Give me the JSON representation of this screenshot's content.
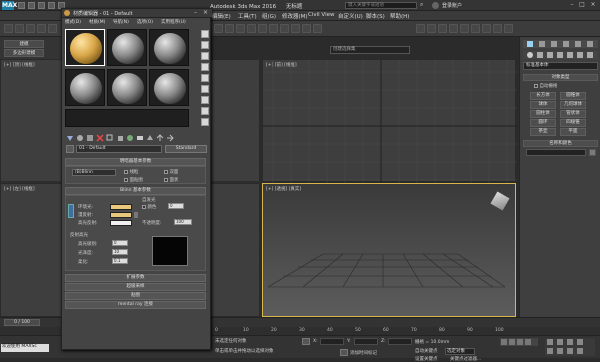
{
  "app": {
    "logo": "MAX",
    "title": "Autodesk 3ds Max 2016",
    "doc_title": "无标题",
    "search_placeholder": "键入关键字或短语",
    "user": "登录账户"
  },
  "menubar": [
    "编辑(E)",
    "工具(T)",
    "组(G)",
    "视图(V)",
    "创建(C)",
    "修改器(M)",
    "动画(A)",
    "图形编辑器(D)",
    "渲染(R)",
    "Civil View",
    "自定义(U)",
    "脚本(S)",
    "帮助(H)"
  ],
  "toolbar": {
    "selection_set": "创建选择集"
  },
  "ribbon": {
    "tab1": "建模",
    "tab2": "多边形建模"
  },
  "viewports": {
    "top_left": "[+] [顶] [线框]",
    "top_right": "[+] [前] [线框]",
    "bottom_left": "[+] [左] [线框]",
    "perspective": "[+] [透视] [真实]"
  },
  "material_editor": {
    "title": "材质编辑器 - 01 - Default",
    "menus": [
      "模式(D)",
      "材质(M)",
      "导航(N)",
      "选项(O)",
      "实用程序(U)"
    ],
    "material_name": "01 - Default",
    "material_type": "Standard",
    "basic_params_header": "明暗器基本参数",
    "shader": "(B)Blinn",
    "checks": [
      "线框",
      "双面",
      "面贴图",
      "面状"
    ],
    "blinn_header": "Blinn 基本参数",
    "self_illum_label": "自发光",
    "color_label": "颜色",
    "color_value": "0",
    "ambient_label": "环境光:",
    "diffuse_label": "漫反射:",
    "specular_label": "高光反射:",
    "opacity_label": "不透明度:",
    "opacity_value": "100",
    "spec_highlights_label": "反射高光",
    "spec_level_label": "高光级别:",
    "spec_level_value": "0",
    "glossiness_label": "光泽度:",
    "glossiness_value": "10",
    "soften_label": "柔化:",
    "soften_value": "0.1",
    "rollouts": [
      "扩展参数",
      "超级采样",
      "贴图",
      "mental ray 连接"
    ]
  },
  "command_panel": {
    "category": "标准基本体",
    "object_type_header": "对象类型",
    "autogrid": "自动栅格",
    "buttons": [
      "长方体",
      "圆锥体",
      "球体",
      "几何球体",
      "圆柱体",
      "管状体",
      "圆环",
      "四棱锥",
      "茶壶",
      "平面"
    ],
    "name_color_header": "名称和颜色"
  },
  "timeline": {
    "frame": "0 / 100",
    "ticks": [
      "0",
      "10",
      "20",
      "30",
      "40",
      "50",
      "60",
      "70",
      "80",
      "90",
      "100"
    ]
  },
  "status": {
    "welcome": "欢迎使用 MAXSc",
    "no_selection": "未选定任何对象",
    "hint": "单击或单击并拖动以选择对象",
    "add_time_tag": "添加时间标记",
    "x_label": "X:",
    "y_label": "Y:",
    "z_label": "Z:",
    "grid": "栅格 = 10.0mm",
    "auto_key": "自动关键点",
    "set_key": "设置关键点",
    "selected": "选定对象",
    "key_filters": "关键点过滤器..."
  },
  "colors": {
    "viewport_active_border": "#d6b64d",
    "diffuse_swatch": "#e8c87a",
    "specular_swatch": "#f0f0f0",
    "accent": "#1f7fa6"
  }
}
